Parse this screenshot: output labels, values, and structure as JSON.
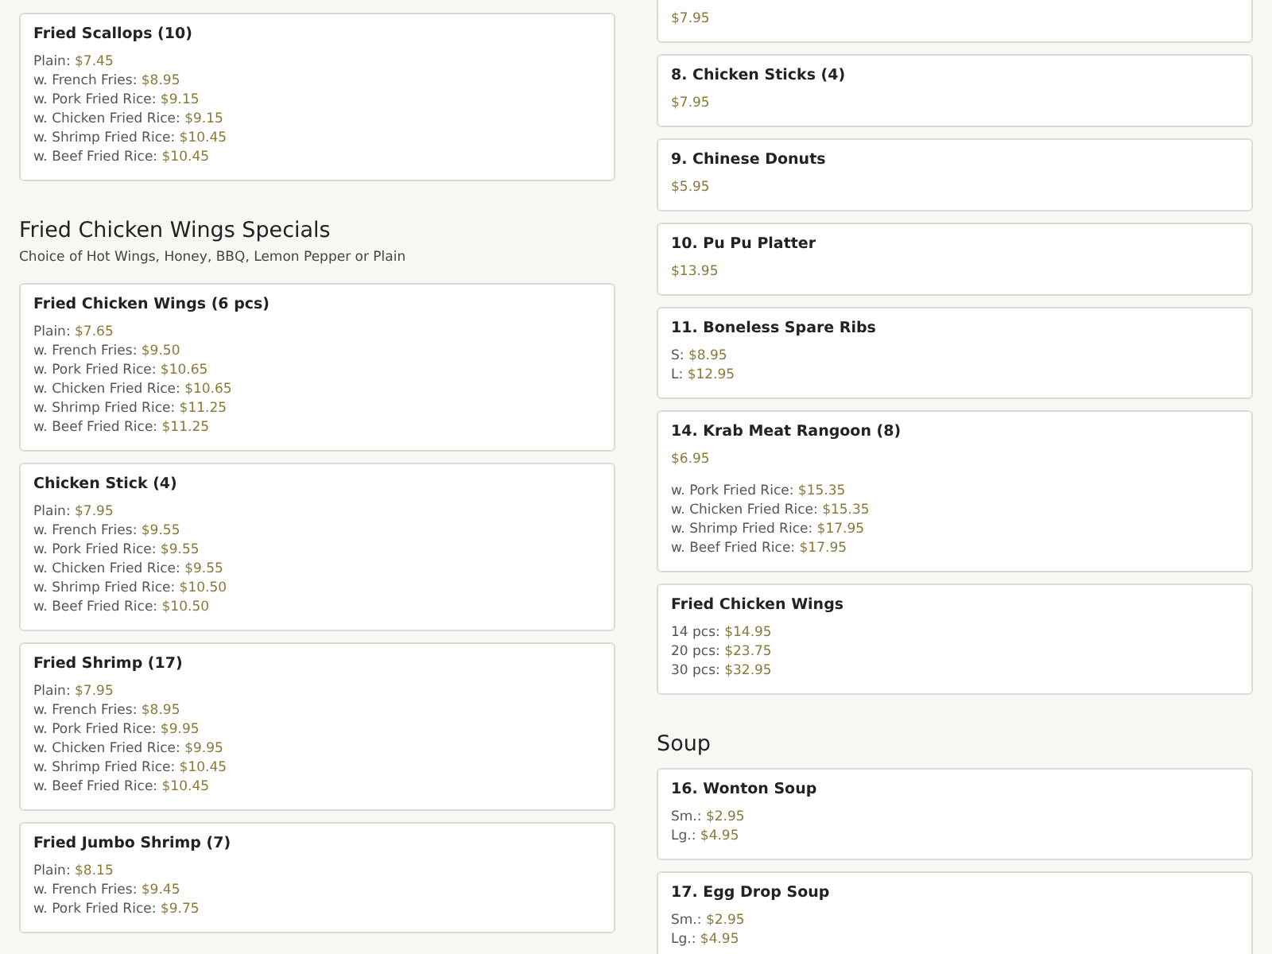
{
  "columns": [
    {
      "sections": [
        {
          "items": [
            {
              "title": "Fried Scallops (10)",
              "prices": [
                {
                  "label": "Plain:",
                  "price": "$7.45"
                },
                {
                  "label": "w. French Fries:",
                  "price": "$8.95"
                },
                {
                  "label": "w. Pork Fried Rice:",
                  "price": "$9.15"
                },
                {
                  "label": "w. Chicken Fried Rice:",
                  "price": "$9.15"
                },
                {
                  "label": "w. Shrimp Fried Rice:",
                  "price": "$10.45"
                },
                {
                  "label": "w. Beef Fried Rice:",
                  "price": "$10.45"
                }
              ]
            }
          ]
        },
        {
          "heading": "Fried Chicken Wings Specials",
          "note": "Choice of Hot Wings, Honey, BBQ, Lemon Pepper or Plain",
          "items": [
            {
              "title": "Fried Chicken Wings (6 pcs)",
              "prices": [
                {
                  "label": "Plain:",
                  "price": "$7.65"
                },
                {
                  "label": "w. French Fries:",
                  "price": "$9.50"
                },
                {
                  "label": "w. Pork Fried Rice:",
                  "price": "$10.65"
                },
                {
                  "label": "w. Chicken Fried Rice:",
                  "price": "$10.65"
                },
                {
                  "label": "w. Shrimp Fried Rice:",
                  "price": "$11.25"
                },
                {
                  "label": "w. Beef Fried Rice:",
                  "price": "$11.25"
                }
              ]
            },
            {
              "title": "Chicken Stick (4)",
              "prices": [
                {
                  "label": "Plain:",
                  "price": "$7.95"
                },
                {
                  "label": "w. French Fries:",
                  "price": "$9.55"
                },
                {
                  "label": "w. Pork Fried Rice:",
                  "price": "$9.55"
                },
                {
                  "label": "w. Chicken Fried Rice:",
                  "price": "$9.55"
                },
                {
                  "label": "w. Shrimp Fried Rice:",
                  "price": "$10.50"
                },
                {
                  "label": "w. Beef Fried Rice:",
                  "price": "$10.50"
                }
              ]
            },
            {
              "title": "Fried Shrimp (17)",
              "prices": [
                {
                  "label": "Plain:",
                  "price": "$7.95"
                },
                {
                  "label": "w. French Fries:",
                  "price": "$8.95"
                },
                {
                  "label": "w. Pork Fried Rice:",
                  "price": "$9.95"
                },
                {
                  "label": "w. Chicken Fried Rice:",
                  "price": "$9.95"
                },
                {
                  "label": "w. Shrimp Fried Rice:",
                  "price": "$10.45"
                },
                {
                  "label": "w. Beef Fried Rice:",
                  "price": "$10.45"
                }
              ]
            },
            {
              "title": "Fried Jumbo Shrimp (7)",
              "prices": [
                {
                  "label": "Plain:",
                  "price": "$8.15"
                },
                {
                  "label": "w. French Fries:",
                  "price": "$9.45"
                },
                {
                  "label": "w. Pork Fried Rice:",
                  "price": "$9.75"
                }
              ]
            }
          ]
        }
      ]
    },
    {
      "sections": [
        {
          "items": [
            {
              "prices": [
                {
                  "price": "$7.95"
                }
              ]
            },
            {
              "title": "8. Chicken Sticks (4)",
              "prices": [
                {
                  "price": "$7.95"
                }
              ]
            },
            {
              "title": "9. Chinese Donuts",
              "prices": [
                {
                  "price": "$5.95"
                }
              ]
            },
            {
              "title": "10. Pu Pu Platter",
              "prices": [
                {
                  "price": "$13.95"
                }
              ]
            },
            {
              "title": "11. Boneless Spare Ribs",
              "prices": [
                {
                  "label": "S:",
                  "price": "$8.95"
                },
                {
                  "label": "L:",
                  "price": "$12.95"
                }
              ]
            },
            {
              "title": "14. Krab Meat Rangoon (8)",
              "prices": [
                {
                  "price": "$6.95"
                }
              ],
              "extras": [
                {
                  "label": "w. Pork Fried Rice:",
                  "price": "$15.35"
                },
                {
                  "label": "w. Chicken Fried Rice:",
                  "price": "$15.35"
                },
                {
                  "label": "w. Shrimp Fried Rice:",
                  "price": "$17.95"
                },
                {
                  "label": "w. Beef Fried Rice:",
                  "price": "$17.95"
                }
              ]
            },
            {
              "title": "Fried Chicken Wings",
              "prices": [
                {
                  "label": "14 pcs:",
                  "price": "$14.95"
                },
                {
                  "label": "20 pcs:",
                  "price": "$23.75"
                },
                {
                  "label": "30 pcs:",
                  "price": "$32.95"
                }
              ]
            }
          ]
        },
        {
          "heading": "Soup",
          "items": [
            {
              "title": "16. Wonton Soup",
              "prices": [
                {
                  "label": "Sm.:",
                  "price": "$2.95"
                },
                {
                  "label": "Lg.:",
                  "price": "$4.95"
                }
              ]
            },
            {
              "title": "17. Egg Drop Soup",
              "prices": [
                {
                  "label": "Sm.:",
                  "price": "$2.95"
                },
                {
                  "label": "Lg.:",
                  "price": "$4.95"
                }
              ]
            }
          ]
        }
      ]
    }
  ]
}
